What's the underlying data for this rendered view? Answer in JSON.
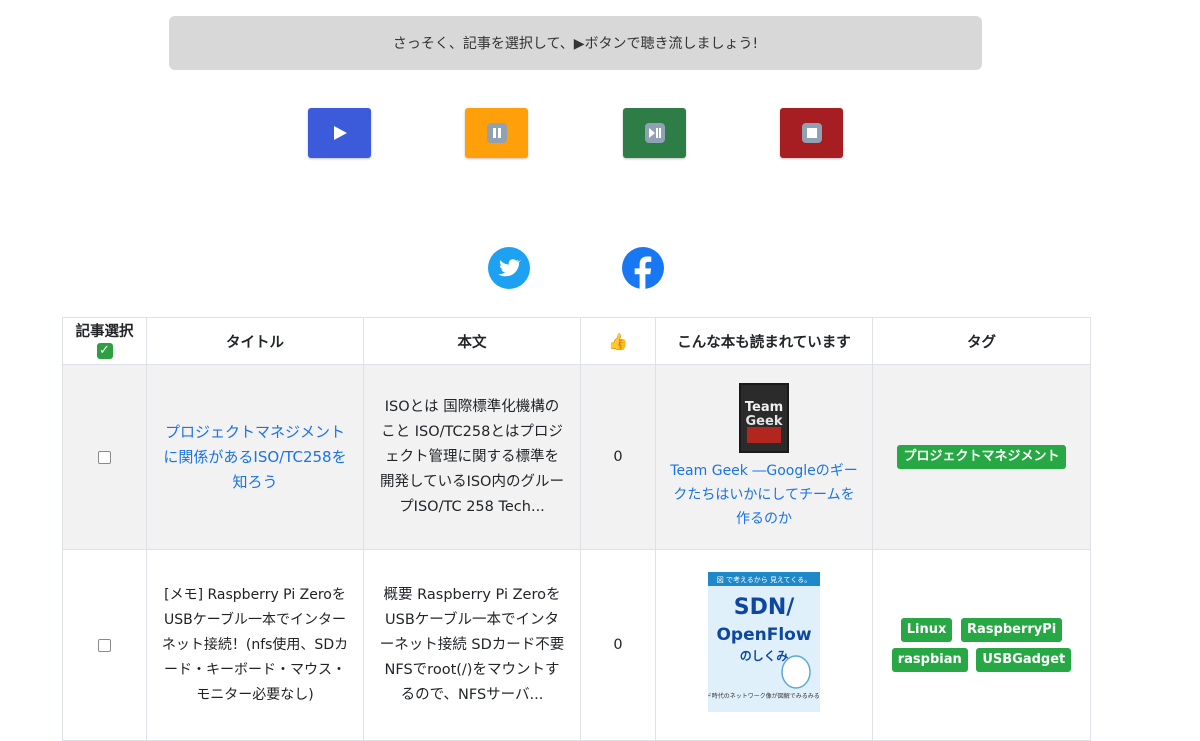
{
  "banner": {
    "text": "さっそく、記事を選択して、▶ボタンで聴き流しましょう!"
  },
  "controls": [
    {
      "name": "play-button",
      "icon": "play-icon",
      "color": "#3b5bdb"
    },
    {
      "name": "pause-button",
      "icon": "pause-icon",
      "color": "#ff9f0a"
    },
    {
      "name": "play-pause-button",
      "icon": "play-pause-icon",
      "color": "#2e7d46"
    },
    {
      "name": "stop-button",
      "icon": "stop-icon",
      "color": "#a61e22"
    }
  ],
  "social": [
    {
      "name": "twitter-icon",
      "color": "#1da1f2"
    },
    {
      "name": "facebook-icon",
      "color": "#1877f2"
    }
  ],
  "table": {
    "headers": {
      "select": "記事選択",
      "select_emoji": "✓",
      "title": "タイトル",
      "body": "本文",
      "likes": "👍",
      "books": "こんな本も読まれています",
      "tags": "タグ"
    },
    "rows": [
      {
        "title": "プロジェクトマネジメントに関係があるISO/TC258を知ろう",
        "body": "ISOとは 国際標準化機構のこと ISO/TC258とはプロジェクト管理に関する標準を開発しているISO内のグループISO/TC 258 Tech...",
        "likes": "0",
        "book": {
          "title": "Team Geek ―Googleのギークたちはいかにしてチームを作るのか",
          "cover_text_1": "Team",
          "cover_text_2": "Geek"
        },
        "tags": [
          "プロジェクトマネジメント"
        ]
      },
      {
        "title": "[メモ] Raspberry Pi ZeroをUSBケーブル一本でインターネット接続！(nfs使用、SDカード・キーボード・マウス・モニター必要なし)",
        "body": "概要 Raspberry Pi ZeroをUSBケーブル一本でインターネット接続 SDカード不要 NFSでroot(/)をマウントするので、NFSサーバ...",
        "likes": "0",
        "book": {
          "title": "",
          "cover_text_1": "SDN/",
          "cover_text_2": "OpenFlow",
          "cover_text_3": "のしくみ",
          "cover_header": "図 で考えるから 見えてくる。",
          "cover_footer": "クラウド時代のネットワーク像が図解でみるみるわかる!"
        },
        "tags": [
          "Linux",
          "RaspberryPi",
          "raspbian",
          "USBGadget"
        ]
      }
    ]
  }
}
